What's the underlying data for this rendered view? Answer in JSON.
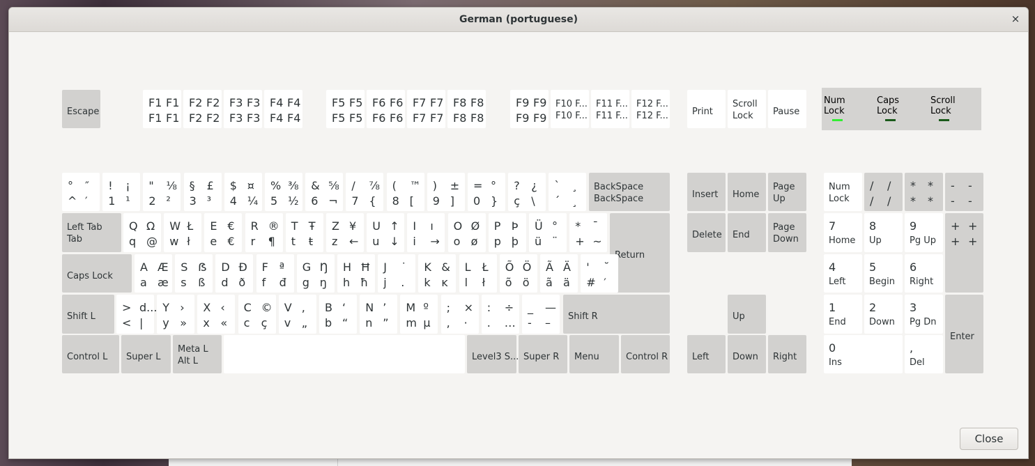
{
  "window": {
    "title": "German (portuguese)",
    "close_icon": "×",
    "close_button": "Close"
  },
  "leds": [
    {
      "label": "Num\nLock",
      "color": "#33ee33"
    },
    {
      "label": "Caps\nLock",
      "color": "#1a5a1a"
    },
    {
      "label": "Scroll\nLock",
      "color": "#1a5a1a"
    }
  ],
  "keys": [
    {
      "id": "escape",
      "style": "g",
      "labels": [
        "Escape"
      ]
    },
    {
      "id": "f1",
      "style": "w",
      "labels": [
        "F1",
        "F1",
        "F1",
        "F1"
      ]
    },
    {
      "id": "f2",
      "style": "w",
      "labels": [
        "F2",
        "F2",
        "F2",
        "F2"
      ]
    },
    {
      "id": "f3",
      "style": "w",
      "labels": [
        "F3",
        "F3",
        "F3",
        "F3"
      ]
    },
    {
      "id": "f4",
      "style": "w",
      "labels": [
        "F4",
        "F4",
        "F4",
        "F4"
      ]
    },
    {
      "id": "f5",
      "style": "w",
      "labels": [
        "F5",
        "F5",
        "F5",
        "F5"
      ]
    },
    {
      "id": "f6",
      "style": "w",
      "labels": [
        "F6",
        "F6",
        "F6",
        "F6"
      ]
    },
    {
      "id": "f7",
      "style": "w",
      "labels": [
        "F7",
        "F7",
        "F7",
        "F7"
      ]
    },
    {
      "id": "f8",
      "style": "w",
      "labels": [
        "F8",
        "F8",
        "F8",
        "F8"
      ]
    },
    {
      "id": "f9",
      "style": "w",
      "labels": [
        "F9",
        "F9",
        "F9",
        "F9"
      ]
    },
    {
      "id": "f10",
      "style": "w",
      "labels": [
        "F10 F...",
        "F10 F..."
      ]
    },
    {
      "id": "f11",
      "style": "w",
      "labels": [
        "F11 F...",
        "F11 F..."
      ]
    },
    {
      "id": "f12",
      "style": "w",
      "labels": [
        "F12 F...",
        "F12 F..."
      ]
    },
    {
      "id": "print",
      "style": "w",
      "labels": [
        "Print"
      ]
    },
    {
      "id": "scroll-lock",
      "style": "w",
      "labels": [
        "Scroll",
        "Lock"
      ]
    },
    {
      "id": "pause",
      "style": "w",
      "labels": [
        "Pause"
      ]
    },
    {
      "id": "circumflex",
      "style": "w",
      "labels": [
        "°",
        "″",
        "^",
        "′"
      ]
    },
    {
      "id": "digit-1",
      "style": "w",
      "labels": [
        "!",
        "¡",
        "1",
        "¹"
      ]
    },
    {
      "id": "digit-2",
      "style": "w",
      "labels": [
        "\"",
        "⅛",
        "2",
        "²"
      ]
    },
    {
      "id": "digit-3",
      "style": "w",
      "labels": [
        "§",
        "£",
        "3",
        "³"
      ]
    },
    {
      "id": "digit-4",
      "style": "w",
      "labels": [
        "$",
        "¤",
        "4",
        "¼"
      ]
    },
    {
      "id": "digit-5",
      "style": "w",
      "labels": [
        "%",
        "⅜",
        "5",
        "½"
      ]
    },
    {
      "id": "digit-6",
      "style": "w",
      "labels": [
        "&",
        "⅝",
        "6",
        "¬"
      ]
    },
    {
      "id": "digit-7",
      "style": "w",
      "labels": [
        "/",
        "⅞",
        "7",
        "{"
      ]
    },
    {
      "id": "digit-8",
      "style": "w",
      "labels": [
        "(",
        "™",
        "8",
        "["
      ]
    },
    {
      "id": "digit-9",
      "style": "w",
      "labels": [
        ")",
        "±",
        "9",
        "]"
      ]
    },
    {
      "id": "digit-0",
      "style": "w",
      "labels": [
        "=",
        "°",
        "0",
        "}"
      ]
    },
    {
      "id": "sharp-s",
      "style": "w",
      "labels": [
        "?",
        "¿",
        "ç",
        "\\"
      ]
    },
    {
      "id": "acute",
      "style": "w",
      "labels": [
        "`",
        "¸",
        "´",
        "¸"
      ]
    },
    {
      "id": "backspace",
      "style": "g",
      "labels": [
        "BackSpace",
        "BackSpace"
      ]
    },
    {
      "id": "tab",
      "style": "g",
      "labels": [
        "Left Tab",
        "Tab"
      ]
    },
    {
      "id": "q",
      "style": "w",
      "labels": [
        "Q",
        "Ω",
        "q",
        "@"
      ]
    },
    {
      "id": "w",
      "style": "w",
      "labels": [
        "W",
        "Ł",
        "w",
        "ł"
      ]
    },
    {
      "id": "e",
      "style": "w",
      "labels": [
        "E",
        "€",
        "e",
        "€"
      ]
    },
    {
      "id": "r",
      "style": "w",
      "labels": [
        "R",
        "®",
        "r",
        "¶"
      ]
    },
    {
      "id": "t",
      "style": "w",
      "labels": [
        "T",
        "Ŧ",
        "t",
        "ŧ"
      ]
    },
    {
      "id": "z",
      "style": "w",
      "labels": [
        "Z",
        "¥",
        "z",
        "←"
      ]
    },
    {
      "id": "u",
      "style": "w",
      "labels": [
        "U",
        "↑",
        "u",
        "↓"
      ]
    },
    {
      "id": "i",
      "style": "w",
      "labels": [
        "I",
        "ı",
        "i",
        "→"
      ]
    },
    {
      "id": "o",
      "style": "w",
      "labels": [
        "O",
        "Ø",
        "o",
        "ø"
      ]
    },
    {
      "id": "p",
      "style": "w",
      "labels": [
        "P",
        "Þ",
        "p",
        "þ"
      ]
    },
    {
      "id": "u-umlaut",
      "style": "w",
      "labels": [
        "Ü",
        "°",
        "ü",
        "¨"
      ]
    },
    {
      "id": "plus",
      "style": "w",
      "labels": [
        "*",
        "¯",
        "+",
        "~"
      ]
    },
    {
      "id": "return",
      "style": "g",
      "labels": [
        "Return"
      ]
    },
    {
      "id": "caps-lock",
      "style": "g",
      "labels": [
        "Caps Lock"
      ]
    },
    {
      "id": "a",
      "style": "w",
      "labels": [
        "A",
        "Æ",
        "a",
        "æ"
      ]
    },
    {
      "id": "s",
      "style": "w",
      "labels": [
        "S",
        "ẞ",
        "s",
        "ß"
      ]
    },
    {
      "id": "d",
      "style": "w",
      "labels": [
        "D",
        "Ð",
        "d",
        "ð"
      ]
    },
    {
      "id": "f",
      "style": "w",
      "labels": [
        "F",
        "ª",
        "f",
        "đ"
      ]
    },
    {
      "id": "g",
      "style": "w",
      "labels": [
        "G",
        "Ŋ",
        "g",
        "ŋ"
      ]
    },
    {
      "id": "h",
      "style": "w",
      "labels": [
        "H",
        "Ħ",
        "h",
        "ħ"
      ]
    },
    {
      "id": "j",
      "style": "w",
      "labels": [
        "J",
        "˙",
        "j",
        "."
      ]
    },
    {
      "id": "k",
      "style": "w",
      "labels": [
        "K",
        "&",
        "k",
        "ĸ"
      ]
    },
    {
      "id": "l",
      "style": "w",
      "labels": [
        "L",
        "Ł",
        "l",
        "ł"
      ]
    },
    {
      "id": "o-umlaut",
      "style": "w",
      "labels": [
        "Õ",
        "Ö",
        "õ",
        "ö"
      ]
    },
    {
      "id": "a-umlaut",
      "style": "w",
      "labels": [
        "Ã",
        "Ä",
        "ã",
        "ä"
      ]
    },
    {
      "id": "hash",
      "style": "w",
      "labels": [
        "'",
        "˘",
        "#",
        "′"
      ]
    },
    {
      "id": "shift-l",
      "style": "g",
      "labels": [
        "Shift L"
      ]
    },
    {
      "id": "less",
      "style": "w",
      "labels": [
        ">",
        "d...",
        "<",
        "|"
      ]
    },
    {
      "id": "y",
      "style": "w",
      "labels": [
        "Y",
        "›",
        "y",
        "»"
      ]
    },
    {
      "id": "x",
      "style": "w",
      "labels": [
        "X",
        "‹",
        "x",
        "«"
      ]
    },
    {
      "id": "c",
      "style": "w",
      "labels": [
        "C",
        "©",
        "c",
        "ç"
      ]
    },
    {
      "id": "v",
      "style": "w",
      "labels": [
        "V",
        ",",
        "v",
        "„"
      ]
    },
    {
      "id": "b",
      "style": "w",
      "labels": [
        "B",
        "‘",
        "b",
        "“"
      ]
    },
    {
      "id": "n",
      "style": "w",
      "labels": [
        "N",
        "’",
        "n",
        "”"
      ]
    },
    {
      "id": "m",
      "style": "w",
      "labels": [
        "M",
        "º",
        "m",
        "µ"
      ]
    },
    {
      "id": "comma",
      "style": "w",
      "labels": [
        ";",
        "×",
        ",",
        "·"
      ]
    },
    {
      "id": "period",
      "style": "w",
      "labels": [
        ":",
        "÷",
        ".",
        "…"
      ]
    },
    {
      "id": "minus",
      "style": "w",
      "labels": [
        "_",
        "—",
        "-",
        "–"
      ]
    },
    {
      "id": "shift-r",
      "style": "g",
      "labels": [
        "Shift R"
      ]
    },
    {
      "id": "control-l",
      "style": "g",
      "labels": [
        "Control L"
      ]
    },
    {
      "id": "super-l",
      "style": "g",
      "labels": [
        "Super L"
      ]
    },
    {
      "id": "alt-l",
      "style": "g",
      "labels": [
        "Meta L",
        "Alt L"
      ]
    },
    {
      "id": "space",
      "style": "w",
      "labels": []
    },
    {
      "id": "level3",
      "style": "g",
      "labels": [
        "Level3 S..."
      ]
    },
    {
      "id": "super-r",
      "style": "g",
      "labels": [
        "Super R"
      ]
    },
    {
      "id": "menu",
      "style": "g",
      "labels": [
        "Menu"
      ]
    },
    {
      "id": "control-r",
      "style": "g",
      "labels": [
        "Control R"
      ]
    },
    {
      "id": "insert",
      "style": "g",
      "labels": [
        "Insert"
      ]
    },
    {
      "id": "home",
      "style": "g",
      "labels": [
        "Home"
      ]
    },
    {
      "id": "page-up",
      "style": "g",
      "labels": [
        "Page",
        "Up"
      ]
    },
    {
      "id": "delete",
      "style": "g",
      "labels": [
        "Delete"
      ]
    },
    {
      "id": "end",
      "style": "g",
      "labels": [
        "End"
      ]
    },
    {
      "id": "page-down",
      "style": "g",
      "labels": [
        "Page",
        "Down"
      ]
    },
    {
      "id": "up",
      "style": "g",
      "labels": [
        "Up"
      ]
    },
    {
      "id": "left",
      "style": "g",
      "labels": [
        "Left"
      ]
    },
    {
      "id": "down",
      "style": "g",
      "labels": [
        "Down"
      ]
    },
    {
      "id": "right",
      "style": "g",
      "labels": [
        "Right"
      ]
    },
    {
      "id": "num-lock",
      "style": "w",
      "labels": [
        "Num",
        "Lock"
      ]
    },
    {
      "id": "kp-divide",
      "style": "g",
      "labels": [
        "/",
        "/",
        "/",
        "/"
      ]
    },
    {
      "id": "kp-multiply",
      "style": "g",
      "labels": [
        "*",
        "*",
        "*",
        "*"
      ]
    },
    {
      "id": "kp-subtract",
      "style": "g",
      "labels": [
        "-",
        "-",
        "-",
        "-"
      ]
    },
    {
      "id": "kp-7",
      "style": "w",
      "labels": [
        "7",
        "Home"
      ]
    },
    {
      "id": "kp-8",
      "style": "w",
      "labels": [
        "8",
        "Up"
      ]
    },
    {
      "id": "kp-9",
      "style": "w",
      "labels": [
        "9",
        "Pg Up"
      ]
    },
    {
      "id": "kp-add",
      "style": "g",
      "labels": [
        "+",
        "+",
        "+",
        "+"
      ]
    },
    {
      "id": "kp-4",
      "style": "w",
      "labels": [
        "4",
        "Left"
      ]
    },
    {
      "id": "kp-5",
      "style": "w",
      "labels": [
        "5",
        "Begin"
      ]
    },
    {
      "id": "kp-6",
      "style": "w",
      "labels": [
        "6",
        "Right"
      ]
    },
    {
      "id": "kp-1",
      "style": "w",
      "labels": [
        "1",
        "End"
      ]
    },
    {
      "id": "kp-2",
      "style": "w",
      "labels": [
        "2",
        "Down"
      ]
    },
    {
      "id": "kp-3",
      "style": "w",
      "labels": [
        "3",
        "Pg Dn"
      ]
    },
    {
      "id": "kp-enter",
      "style": "g",
      "labels": [
        "Enter"
      ]
    },
    {
      "id": "kp-0",
      "style": "w",
      "labels": [
        "0",
        "Ins"
      ]
    },
    {
      "id": "kp-decimal",
      "style": "w",
      "labels": [
        ",",
        "Del"
      ]
    }
  ]
}
